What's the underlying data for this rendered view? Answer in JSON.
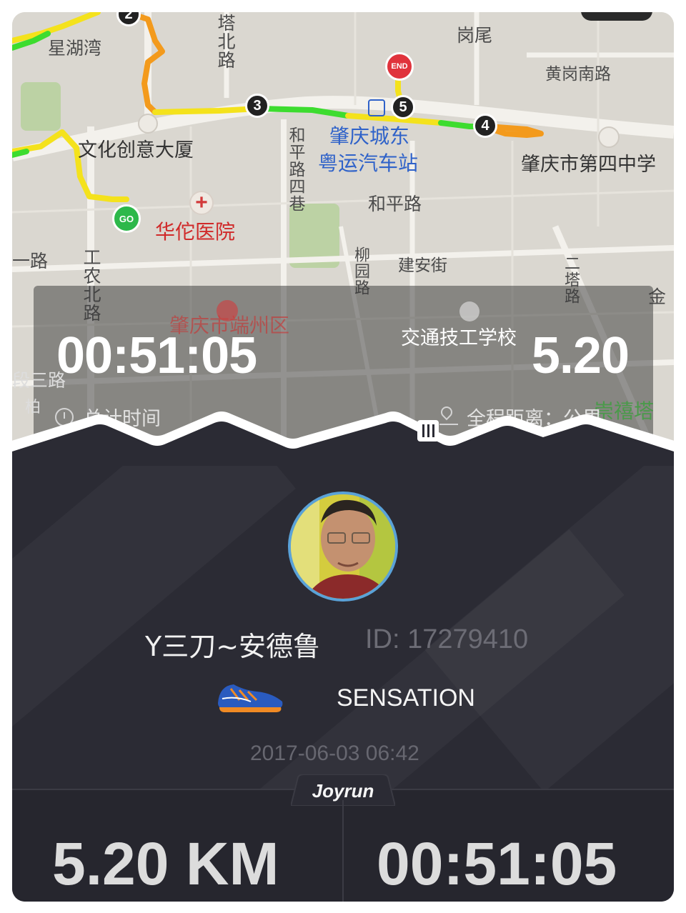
{
  "map": {
    "labels": {
      "xinghuwan": "星湖湾",
      "tabeilu": "塔北路",
      "ganwei": "岗尾",
      "huanggangnanlu": "黄岗南路",
      "wenhua": "文化创意大厦",
      "heping4": "和平路四巷",
      "zhaoqing_east_1": "肇庆城东",
      "zhaoqing_east_2": "粤运汽车站",
      "school4": "肇庆市第四中学",
      "hepinglu": "和平路",
      "huatuo": "华佗医院",
      "yilu": "一路",
      "gongnongbeilu": "工农北路",
      "liuyuanlu": "柳园路",
      "jiananjie": "建安街",
      "ertalu": "二塔路",
      "jin": "金",
      "duanzhou": "肇庆市端州区",
      "jiaotong": "交通技工学校",
      "sansanlu": "段三路",
      "chonghe": "崇禧塔",
      "bai": "柏"
    },
    "markers": {
      "m2": "2",
      "m3": "3",
      "m4": "4",
      "m5": "5",
      "go": "GO",
      "end": "END"
    }
  },
  "summary": {
    "total_time": "00:51:05",
    "total_time_label": "总计时间",
    "distance": "5.20",
    "distance_label": "全程距离：公里"
  },
  "profile": {
    "username": "Y三刀~安德鲁",
    "user_id": "ID: 17279410",
    "shoe": "SENSATION",
    "datetime": "2017-06-03 06:42"
  },
  "brand": "Joyrun",
  "footer": {
    "distance": "5.20 KM",
    "time": "00:51:05"
  },
  "colors": {
    "route_green": "#3ddc2f",
    "route_yellow": "#f4e21c",
    "route_orange": "#f39a1c",
    "card_dark": "#2b2b34",
    "avatar_ring": "#5aa2d8"
  }
}
